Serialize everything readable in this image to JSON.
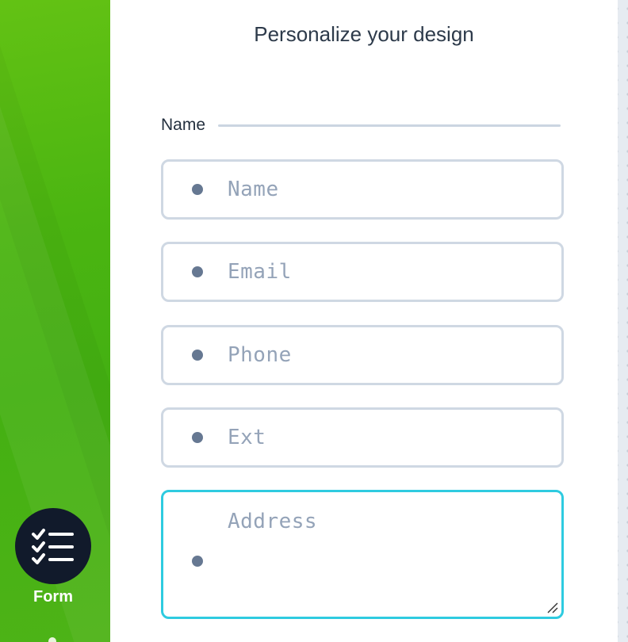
{
  "title": "Personalize your design",
  "section": {
    "label": "Name"
  },
  "fields": [
    {
      "placeholder": "Name"
    },
    {
      "placeholder": "Email"
    },
    {
      "placeholder": "Phone"
    },
    {
      "placeholder": "Ext"
    },
    {
      "placeholder": "Address"
    }
  ],
  "sidebar": {
    "active_item": {
      "label": "Form",
      "icon": "checklist-icon"
    }
  },
  "colors": {
    "rail_green": "#4bb511",
    "icon_circle": "#111a2b",
    "focus_border": "#2ecbe0",
    "field_border": "#cfd8e3",
    "title_text": "#2d3a4a",
    "placeholder_text": "#94a3b8",
    "bullet_dot": "#667892"
  }
}
